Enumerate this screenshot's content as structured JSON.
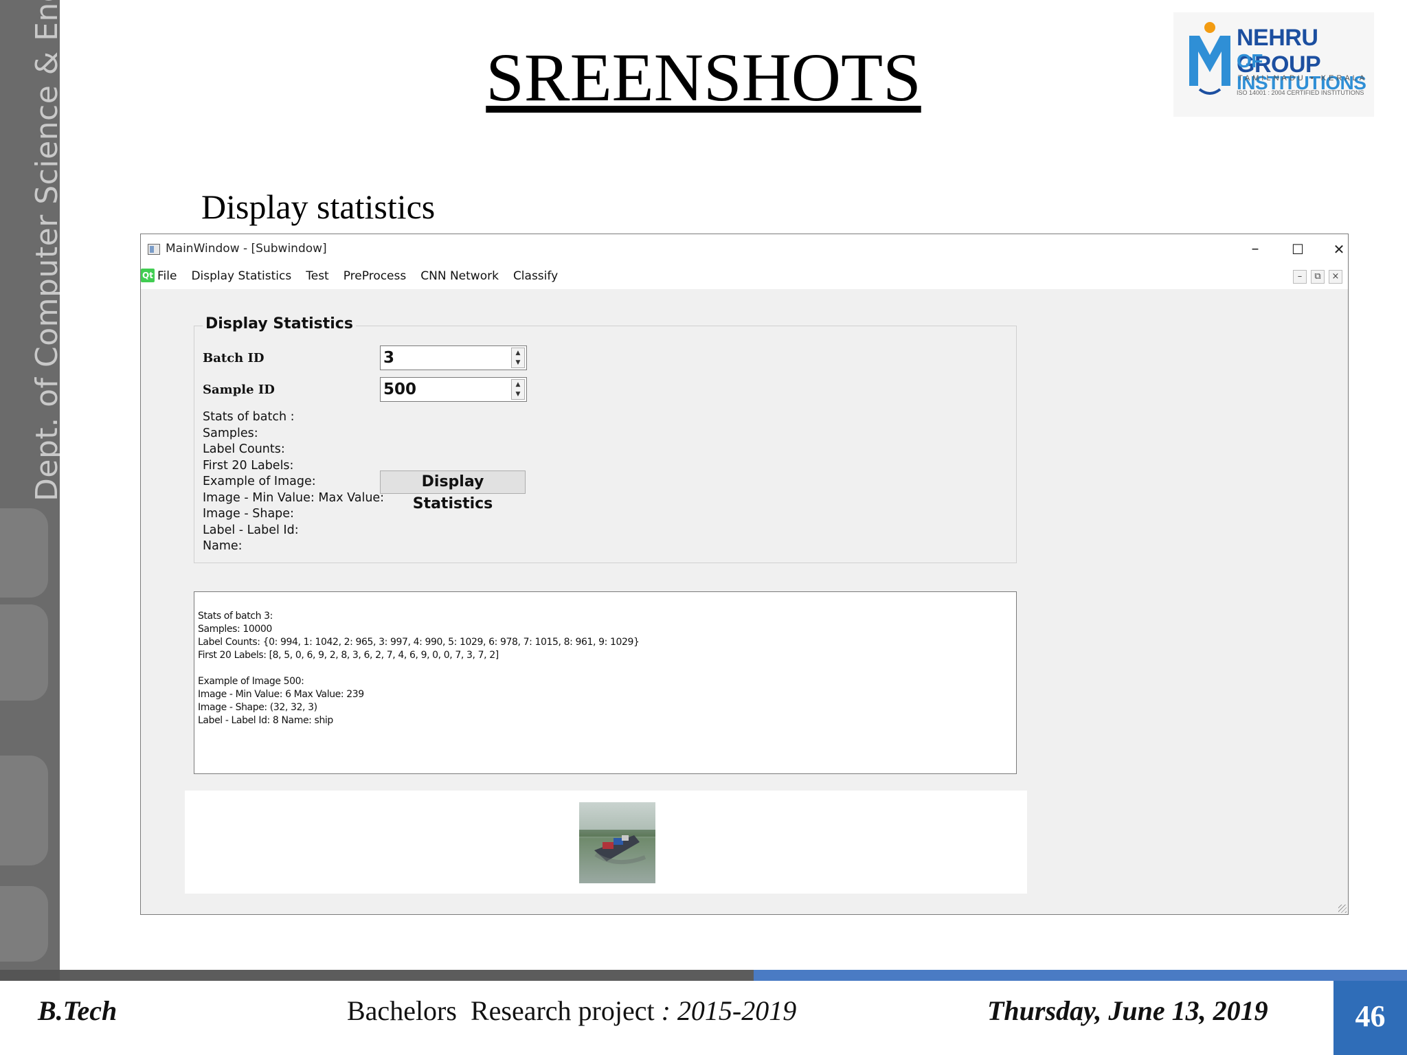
{
  "sidebar": {
    "text": "Dept. of Computer Science & Engg."
  },
  "slide": {
    "title": "SREENSHOTS",
    "subtitle": "Display statistics"
  },
  "logo": {
    "line1": "NEHRU GROUP",
    "line2": "OF INSTITUTIONS",
    "line3": "TAMILNADU • KERALA",
    "line4": "ISO 14001 : 2004 CERTIFIED INSTITUTIONS"
  },
  "window": {
    "title": "MainWindow - [Subwindow]",
    "controls": {
      "minimize": "–",
      "maximize": "☐",
      "close": "✕"
    },
    "menu": [
      "File",
      "Display Statistics",
      "Test",
      "PreProcess",
      "CNN Network",
      "Classify"
    ],
    "qt_label": "Qt",
    "mdi": {
      "minimize": "–",
      "restore": "⧉",
      "close": "×"
    }
  },
  "group": {
    "title": "Display Statistics",
    "batch_label": "Batch ID",
    "batch_value": "3",
    "sample_label": "Sample ID",
    "sample_value": "500",
    "stat_labels": [
      "Stats of batch :",
      "Samples:",
      "Label Counts:",
      "First 20 Labels:",
      "Example of Image:",
      "Image - Min Value: Max Value:",
      "Image - Shape:",
      "Label - Label Id:",
      "Name:"
    ],
    "button_label": "Display Statistics"
  },
  "output": {
    "lines": [
      "Stats of batch 3:",
      "Samples: 10000",
      "Label Counts: {0: 994, 1: 1042, 2: 965, 3: 997, 4: 990, 5: 1029, 6: 978, 7: 1015, 8: 961, 9: 1029}",
      "First 20 Labels: [8, 5, 0, 6, 9, 2, 8, 3, 6, 2, 7, 4, 6, 9, 0, 0, 7, 3, 7, 2]",
      "",
      "Example of Image 500:",
      "Image - Min Value: 6 Max Value: 239",
      "Image - Shape: (32, 32, 3)",
      "Label - Label Id: 8 Name: ship"
    ]
  },
  "footer": {
    "left": "B.Tech",
    "center_main": "Bachelors  Research project",
    "center_italic": " : 2015-2019",
    "right": "Thursday, June 13, 2019",
    "page": "46"
  },
  "colors": {
    "accent_blue": "#2f6db8",
    "sidebar_gray": "#6b6b6b",
    "qt_green": "#41cd52"
  }
}
